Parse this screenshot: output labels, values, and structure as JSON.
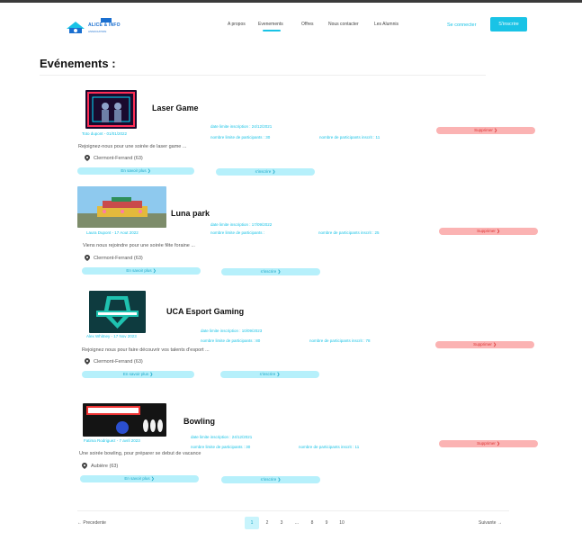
{
  "header": {
    "logo_text": "ALICE & INFO",
    "logo_sub": "ASSOCIATION",
    "nav": [
      {
        "label": "A propos"
      },
      {
        "label": "Evenements"
      },
      {
        "label": "Offres"
      },
      {
        "label": "Nous contacter"
      },
      {
        "label": "Les Alumnis"
      }
    ],
    "connect_label": "Se connecter",
    "signup_label": "S'inscrire"
  },
  "page": {
    "title": "Evénements :"
  },
  "labels": {
    "more": "En savoir plus ❯",
    "subscribe": "s'inscrire ❯",
    "delete": "Supprimer ❯"
  },
  "events": [
    {
      "title": "Laser Game",
      "author": "Toto dupont - 01/01/2022",
      "deadline": "date limite inscription : 24/12/2021",
      "limit": "nombre limite de participants : 30",
      "registered": "nombre de participants inscrit : 11",
      "description": "Rejoignez-nous pour une soirée de laser game ...",
      "location": "Clermont-Ferrand (63)"
    },
    {
      "title": "Luna park",
      "author": "Laura Dupont - 17 Aout 2022",
      "deadline": "date limite inscription : 17/09/2022",
      "limit": "nombre limite de participants :",
      "registered": "nombre de participants inscrit : 25",
      "description": "Viens nous rejoindre pour une soirée fête foraine ...",
      "location": "Clermont-Ferrand (63)"
    },
    {
      "title": "UCA Esport Gaming",
      "author": "Alex Whitney - 17 Nov 2023",
      "deadline": "date limite inscription : 10/09/2023",
      "limit": "nombre limite de participants : 80",
      "registered": "nombre de participants inscrit : 78",
      "description": "Rejoignez nous pour faire découvrir vos talents d'esport ...",
      "location": "Clermont-Ferrand (63)"
    },
    {
      "title": "Bowling",
      "author": "Fatima Rodriguez - 7 avril 2023",
      "deadline": "date limite inscription : 24/12/2021",
      "limit": "nombre limite de participants : 30",
      "registered": "nombre de participants inscrit : 11",
      "description": "Une soirée bowling, pour préparer se debut de vacance",
      "location": "Aubière (63)"
    }
  ],
  "pagination": {
    "prev": "Precedente",
    "next": "Suivante",
    "pages": [
      "1",
      "2",
      "3",
      "...",
      "8",
      "9",
      "10"
    ],
    "current": "1"
  },
  "colors": {
    "accent": "#19c3e6",
    "delete_bg": "#fbb3b3",
    "button_bg": "#b6f0fb"
  }
}
